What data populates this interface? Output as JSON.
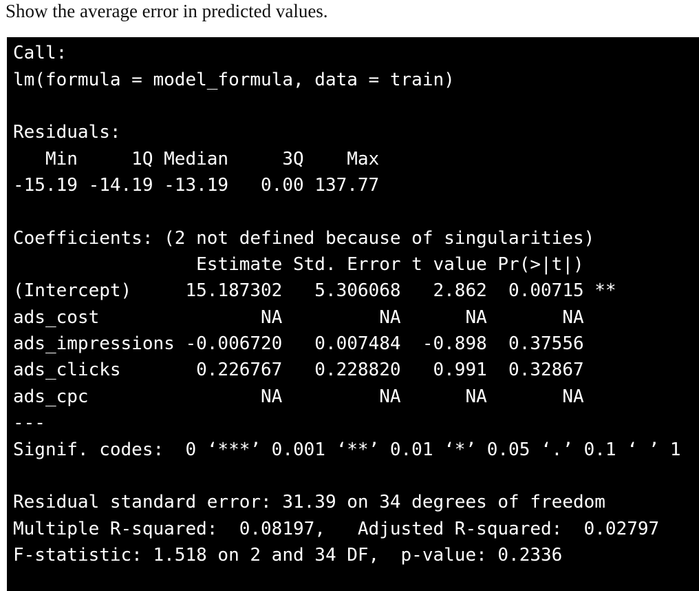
{
  "question": "Show the average error in predicted values.",
  "terminal": {
    "lines": [
      "Call:",
      "lm(formula = model_formula, data = train)",
      "",
      "Residuals:",
      "   Min     1Q Median     3Q    Max ",
      "-15.19 -14.19 -13.19   0.00 137.77 ",
      "",
      "Coefficients: (2 not defined because of singularities)",
      "                 Estimate Std. Error t value Pr(>|t|)   ",
      "(Intercept)     15.187302   5.306068   2.862  0.00715 **",
      "ads_cost               NA         NA      NA       NA   ",
      "ads_impressions -0.006720   0.007484  -0.898  0.37556   ",
      "ads_clicks       0.226767   0.228820   0.991  0.32867   ",
      "ads_cpc                NA         NA      NA       NA   ",
      "---",
      "Signif. codes:  0 ‘***’ 0.001 ‘**’ 0.01 ‘*’ 0.05 ‘.’ 0.1 ‘ ’ 1",
      "",
      "Residual standard error: 31.39 on 34 degrees of freedom",
      "Multiple R-squared:  0.08197,   Adjusted R-squared:  0.02797 ",
      "F-statistic: 1.518 on 2 and 34 DF,  p-value: 0.2336"
    ]
  }
}
